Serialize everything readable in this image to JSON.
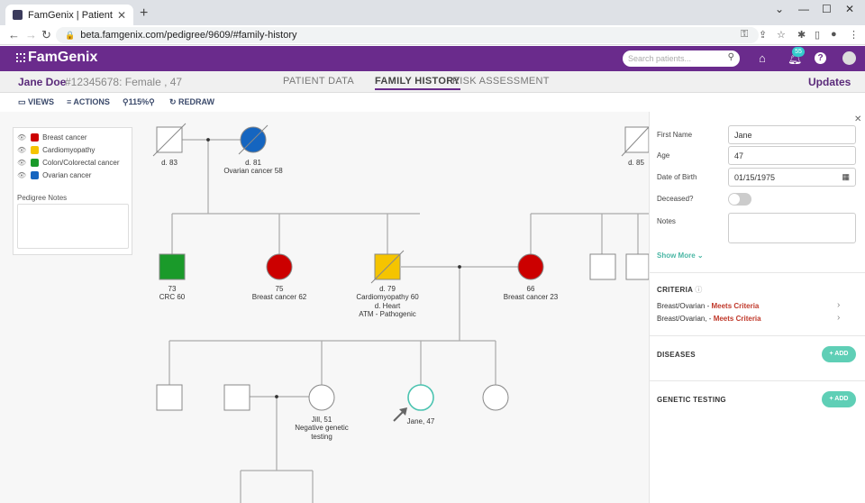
{
  "browser": {
    "tab_title": "FamGenix | Patient Profile",
    "url": "beta.famgenix.com/pedigree/9609/#family-history"
  },
  "app": {
    "logo": "FamGenix",
    "search_placeholder": "Search patients...",
    "notification_count": "55"
  },
  "patient": {
    "name": "Jane Doe",
    "info": "#12345678:  Female , 47"
  },
  "tabs": [
    {
      "label": "PATIENT DATA"
    },
    {
      "label": "FAMILY HISTORY"
    },
    {
      "label": "RISK ASSESSMENT"
    }
  ],
  "updates_label": "Updates",
  "toolbar": {
    "views": "VIEWS",
    "actions": "ACTIONS",
    "zoom": "115%",
    "redraw": "REDRAW"
  },
  "legend": {
    "items": [
      {
        "label": "Breast cancer",
        "color": "#cc0000"
      },
      {
        "label": "Cardiomyopathy",
        "color": "#f5c400"
      },
      {
        "label": "Colon/Colorectal cancer",
        "color": "#1a9a2a"
      },
      {
        "label": "Ovarian cancer",
        "color": "#1565c0"
      }
    ],
    "notes_label": "Pedigree Notes"
  },
  "pedigree": {
    "gp_male": "d. 83",
    "gp_female_1": "d. 81",
    "gp_female_2": "Ovarian cancer 58",
    "gp2_male": "d. 85",
    "uncle_1": "73",
    "uncle_2": "CRC 60",
    "aunt_1": "75",
    "aunt_2": "Breast cancer 62",
    "father_1": "d. 79",
    "father_2": "Cardiomyopathy 60",
    "father_3": "d. Heart",
    "father_4": "ATM - Pathogenic",
    "mother_1": "66",
    "mother_2": "Breast cancer 23",
    "jill_1": "Jill, 51",
    "jill_2": "Negative genetic",
    "jill_3": "testing",
    "jane": "Jane, 47"
  },
  "panel": {
    "first_name_label": "First Name",
    "first_name_value": "Jane",
    "age_label": "Age",
    "age_value": "47",
    "dob_label": "Date of Birth",
    "dob_value": "01/15/1975",
    "deceased_label": "Deceased?",
    "notes_label": "Notes",
    "show_more": "Show More",
    "criteria_title": "CRITERIA",
    "criteria": [
      {
        "label": "Breast/Ovarian - ",
        "status": "Meets Criteria"
      },
      {
        "label": "Breast/Ovarian, - ",
        "status": "Meets Criteria"
      }
    ],
    "diseases_title": "DISEASES",
    "genetic_title": "GENETIC TESTING",
    "add_label": "+ ADD"
  }
}
